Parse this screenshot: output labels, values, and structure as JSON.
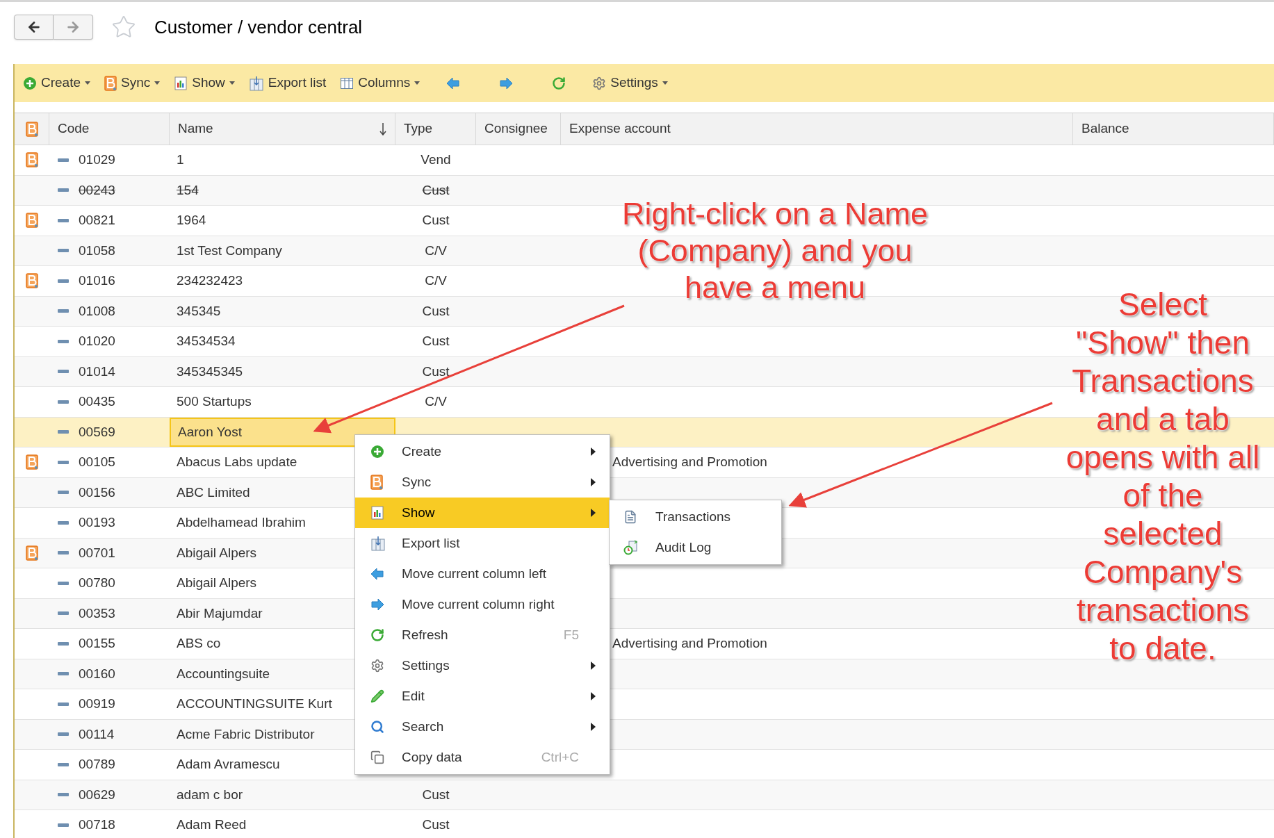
{
  "window": {
    "title": "Customer / vendor central",
    "favorite": false
  },
  "toolbar": [
    {
      "kind": "create",
      "label": "Create",
      "dropdown": true
    },
    {
      "kind": "sync",
      "label": "Sync",
      "dropdown": true
    },
    {
      "kind": "show",
      "label": "Show",
      "dropdown": true
    },
    {
      "kind": "export",
      "label": "Export list",
      "dropdown": false
    },
    {
      "kind": "columns",
      "label": "Columns",
      "dropdown": true
    },
    {
      "kind": "left",
      "dropdown": false
    },
    {
      "kind": "right",
      "dropdown": false
    },
    {
      "kind": "refresh",
      "dropdown": false
    },
    {
      "kind": "settings",
      "label": "Settings",
      "dropdown": true
    }
  ],
  "table": {
    "columns": [
      {
        "label": "Code",
        "sorted": false
      },
      {
        "label": "Name",
        "sorted": true
      },
      {
        "label": "Type",
        "sorted": false
      },
      {
        "label": "Consignee",
        "sorted": false
      },
      {
        "label": "Expense account",
        "sorted": false
      },
      {
        "label": "Balance",
        "sorted": false
      }
    ],
    "rows": [
      {
        "synced": true,
        "deleted": false,
        "selected": false,
        "code": "01029",
        "name": "1",
        "type": "Vend"
      },
      {
        "synced": false,
        "deleted": true,
        "selected": false,
        "code": "00243",
        "name": "154",
        "type": "Cust"
      },
      {
        "synced": true,
        "deleted": false,
        "selected": false,
        "code": "00821",
        "name": "1964",
        "type": "Cust"
      },
      {
        "synced": false,
        "deleted": false,
        "selected": false,
        "code": "01058",
        "name": "1st Test Company",
        "type": "C/V"
      },
      {
        "synced": true,
        "deleted": false,
        "selected": false,
        "code": "01016",
        "name": "234232423",
        "type": "C/V"
      },
      {
        "synced": false,
        "deleted": false,
        "selected": false,
        "code": "01008",
        "name": "345345",
        "type": "Cust"
      },
      {
        "synced": false,
        "deleted": false,
        "selected": false,
        "code": "01020",
        "name": "34534534",
        "type": "Cust"
      },
      {
        "synced": false,
        "deleted": false,
        "selected": false,
        "code": "01014",
        "name": "345345345",
        "type": "Cust"
      },
      {
        "synced": false,
        "deleted": false,
        "selected": false,
        "code": "00435",
        "name": "500 Startups",
        "type": "C/V"
      },
      {
        "synced": false,
        "deleted": false,
        "selected": true,
        "code": "00569",
        "name": "Aaron Yost"
      },
      {
        "synced": true,
        "deleted": false,
        "selected": false,
        "code": "00105",
        "name": "Abacus Labs update",
        "expense": "Advertising and Promotion"
      },
      {
        "synced": false,
        "deleted": false,
        "selected": false,
        "code": "00156",
        "name": "ABC Limited"
      },
      {
        "synced": false,
        "deleted": false,
        "selected": false,
        "code": "00193",
        "name": "Abdelhamead Ibrahim"
      },
      {
        "synced": true,
        "deleted": false,
        "selected": false,
        "code": "00701",
        "name": "Abigail Alpers"
      },
      {
        "synced": false,
        "deleted": false,
        "selected": false,
        "code": "00780",
        "name": "Abigail Alpers"
      },
      {
        "synced": false,
        "deleted": false,
        "selected": false,
        "code": "00353",
        "name": "Abir Majumdar"
      },
      {
        "synced": false,
        "deleted": false,
        "selected": false,
        "code": "00155",
        "name": "ABS co",
        "expense": "Advertising and Promotion"
      },
      {
        "synced": false,
        "deleted": false,
        "selected": false,
        "code": "00160",
        "name": "Accountingsuite"
      },
      {
        "synced": false,
        "deleted": false,
        "selected": false,
        "code": "00919",
        "name": "ACCOUNTINGSUITE Kurt"
      },
      {
        "synced": false,
        "deleted": false,
        "selected": false,
        "code": "00114",
        "name": "Acme Fabric Distributor"
      },
      {
        "synced": false,
        "deleted": false,
        "selected": false,
        "code": "00789",
        "name": "Adam Avramescu"
      },
      {
        "synced": false,
        "deleted": false,
        "selected": false,
        "code": "00629",
        "name": "adam c bor",
        "type": "Cust"
      },
      {
        "synced": false,
        "deleted": false,
        "selected": false,
        "code": "00718",
        "name": "Adam Reed",
        "type": "Cust"
      }
    ]
  },
  "context_menu": {
    "items": [
      {
        "kind": "create",
        "label": "Create",
        "submenu": true,
        "selected": false
      },
      {
        "kind": "sync",
        "label": "Sync",
        "submenu": true,
        "selected": false
      },
      {
        "kind": "show",
        "label": "Show",
        "submenu": true,
        "selected": true
      },
      {
        "kind": "export",
        "label": "Export list",
        "submenu": false,
        "selected": false
      },
      {
        "kind": "left",
        "label": "Move current column left",
        "submenu": false,
        "selected": false
      },
      {
        "kind": "right",
        "label": "Move current column right",
        "submenu": false,
        "selected": false
      },
      {
        "kind": "refresh",
        "label": "Refresh",
        "shortcut": "F5",
        "submenu": false,
        "selected": false
      },
      {
        "kind": "settings",
        "label": "Settings",
        "submenu": true,
        "selected": false
      },
      {
        "kind": "edit",
        "label": "Edit",
        "submenu": true,
        "selected": false
      },
      {
        "kind": "search",
        "label": "Search",
        "submenu": true,
        "selected": false
      },
      {
        "kind": "copy",
        "label": "Copy data",
        "shortcut": "Ctrl+C",
        "submenu": false,
        "selected": false
      }
    ],
    "submenu": [
      {
        "kind": "transactions",
        "label": "Transactions"
      },
      {
        "kind": "audit",
        "label": "Audit Log"
      }
    ]
  },
  "annotations": [
    {
      "text": "Right-click on a Name\n(Company) and you\nhave a menu"
    },
    {
      "text": "Select\n\"Show\" then\nTransactions\nand a tab\nopens with all\nof the\nselected\nCompany's\ntransactions\nto date."
    }
  ]
}
